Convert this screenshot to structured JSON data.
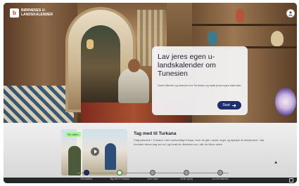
{
  "header": {
    "logo_text": "Børnenes U-landskalender",
    "logo_mark": "b"
  },
  "hero": {
    "title": "Lav jeres egen u-landskalender om Tunesien",
    "text": "Saml billeder og historier fra Tunesien og skab jeres egen kalender.",
    "start_label": "Start",
    "start_icon": "arrow-right-icon"
  },
  "story": {
    "tag": "Se video",
    "title": "Tag med til Turkana",
    "text": "Følg børnene i Turkana i det nordvestlige Kenya, hvor de går i skole, leger og hjælper til derhjemme. Hør, hvordan deres dag ser ud, og hvad de drømmer om, når de bliver store."
  },
  "timeline": {
    "items": [
      {
        "label": "Introduktion"
      },
      {
        "label": "Tag med til Turkana"
      },
      {
        "label": "Livet i byen"
      },
      {
        "label": "Skole og leg"
      },
      {
        "label": "Lav din kalender"
      }
    ]
  },
  "colors": {
    "accent": "#1d2e6e",
    "tag_bg": "#a5f39a",
    "card_bg": "#f5f5f7",
    "timeline_bg": "#262629"
  }
}
